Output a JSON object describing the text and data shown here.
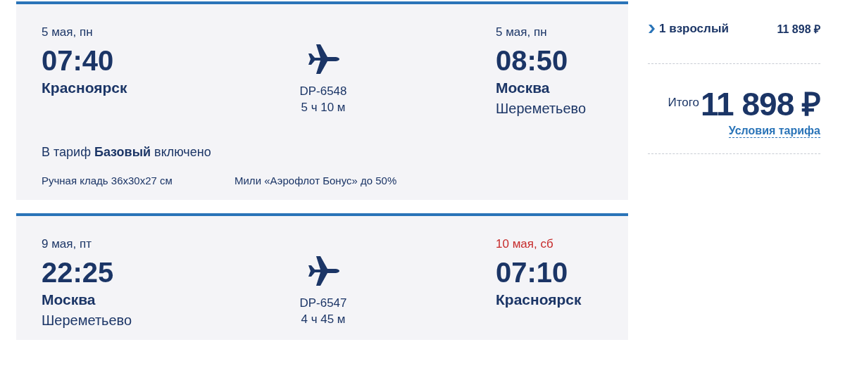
{
  "flights": [
    {
      "departure": {
        "date": "5 мая, пн",
        "next_day": false,
        "time": "07:40",
        "city": "Красноярск"
      },
      "flight": {
        "number": "DP-6548",
        "duration": "5 ч 10 м"
      },
      "arrival": {
        "date": "5 мая, пн",
        "next_day": false,
        "time": "08:50",
        "city": "Москва",
        "airport": "Шереметьево"
      },
      "fare": {
        "title": "В тариф **Базовый** включено",
        "items": [
          "Ручная кладь 36х30х27 см",
          "Мили «Аэрофлот Бонус» до 50%"
        ]
      }
    },
    {
      "departure": {
        "date": "9 мая, пт",
        "next_day": false,
        "time": "22:25",
        "city": "Москва",
        "airport": "Шереметьево"
      },
      "flight": {
        "number": "DP-6547",
        "duration": "4 ч 45 м"
      },
      "arrival": {
        "date": "10 мая, сб",
        "next_day": true,
        "time": "07:10",
        "city": "Красноярск"
      }
    }
  ],
  "summary": {
    "passengers": "1 взрослый",
    "passenger_price": "11 898 ₽",
    "total_label": "Итого",
    "total": "11 898 ₽",
    "tariff_link": "Условия тарифа"
  }
}
